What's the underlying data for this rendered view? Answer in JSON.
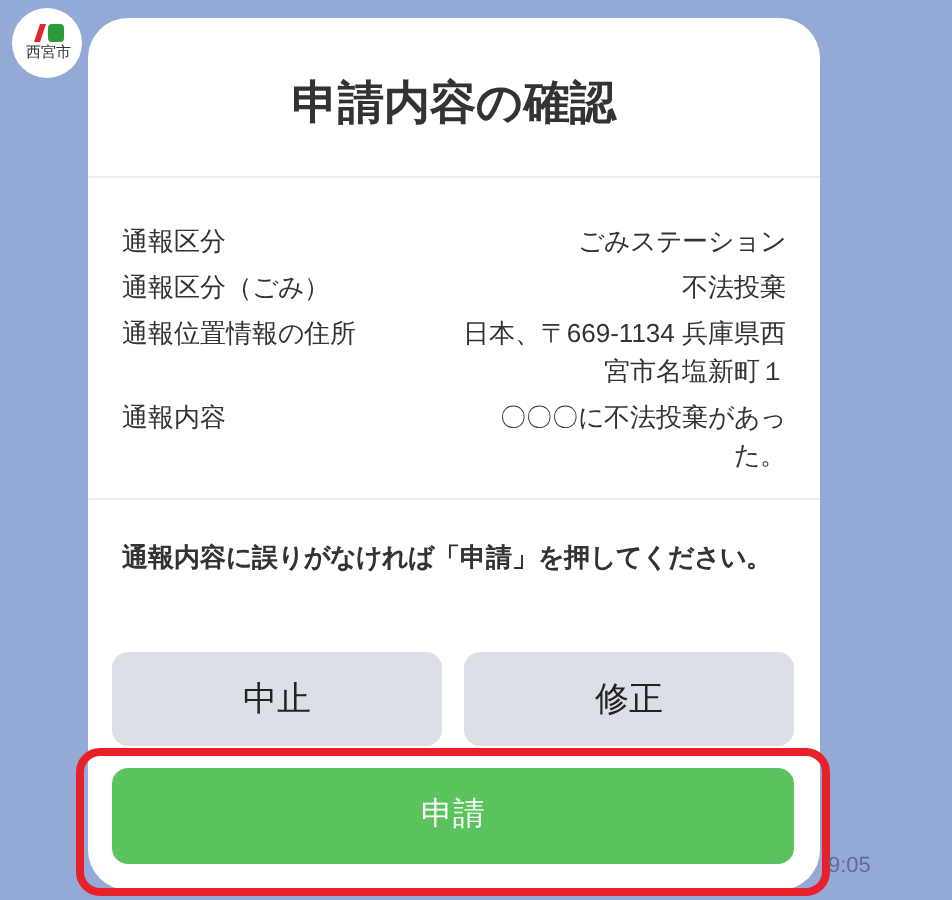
{
  "avatar": {
    "logo_text": "西宮市"
  },
  "card": {
    "title": "申請内容の確認",
    "rows": [
      {
        "label": "通報区分",
        "value": "ごみステーション"
      },
      {
        "label": "通報区分（ごみ）",
        "value": "不法投棄"
      },
      {
        "label": "通報位置情報の住所",
        "value": "日本、〒669-1134 兵庫県西宮市名塩新町１"
      },
      {
        "label": "通報内容",
        "value": "〇〇〇に不法投棄があった。"
      }
    ],
    "note": "通報内容に誤りがなければ「申請」を押してください。",
    "buttons": [
      {
        "label": "中止",
        "kind": "secondary",
        "highlighted": false
      },
      {
        "label": "修正",
        "kind": "secondary",
        "highlighted": false
      },
      {
        "label": "申請",
        "kind": "primary",
        "highlighted": true
      }
    ]
  },
  "time": "9:05"
}
